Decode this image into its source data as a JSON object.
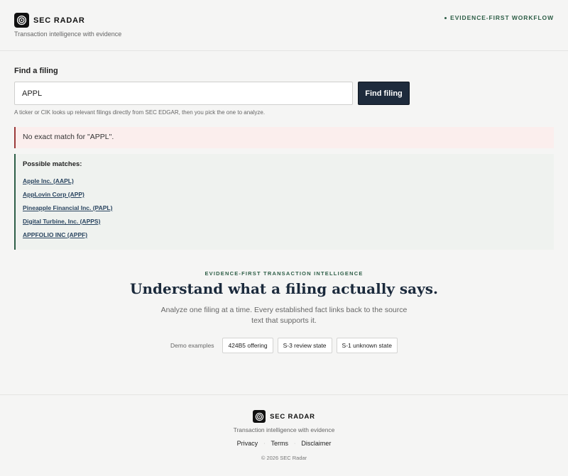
{
  "header": {
    "brand_name": "SEC RADAR",
    "tagline": "Transaction intelligence with evidence",
    "workflow_label": "EVIDENCE-FIRST WORKFLOW",
    "logo_icon": "radar-target-icon"
  },
  "search": {
    "label": "Find a filing",
    "value": "APPL",
    "button_label": "Find filing",
    "help_text": "A ticker or CIK looks up relevant filings directly from SEC EDGAR, then you pick the one to analyze."
  },
  "alert": {
    "message": "No exact match for \"APPL\"."
  },
  "matches": {
    "title": "Possible matches:",
    "items": [
      {
        "label": "Apple Inc. (AAPL)"
      },
      {
        "label": "AppLovin Corp (APP)"
      },
      {
        "label": "Pineapple Financial Inc. (PAPL)"
      },
      {
        "label": "Digital Turbine, Inc. (APPS)"
      },
      {
        "label": "APPFOLIO INC (APPF)"
      }
    ]
  },
  "hero": {
    "eyebrow": "EVIDENCE-FIRST TRANSACTION INTELLIGENCE",
    "title": "Understand what a filing actually says.",
    "subtitle": "Analyze one filing at a time. Every established fact links back to the source text that supports it."
  },
  "demo": {
    "label": "Demo examples",
    "buttons": [
      {
        "label": "424B5 offering"
      },
      {
        "label": "S-3 review state"
      },
      {
        "label": "S-1 unknown state"
      }
    ]
  },
  "footer": {
    "brand_name": "SEC RADAR",
    "tagline": "Transaction intelligence with evidence",
    "links": [
      {
        "label": "Privacy"
      },
      {
        "label": "Terms"
      },
      {
        "label": "Disclaimer"
      }
    ],
    "copyright": "© 2026 SEC Radar"
  },
  "colors": {
    "accent_green": "#2e5e47",
    "primary_button": "#1e2b3c",
    "alert_border": "#9b3a3a",
    "alert_bg": "#fbeeed",
    "matches_bg": "#eff2ef"
  }
}
